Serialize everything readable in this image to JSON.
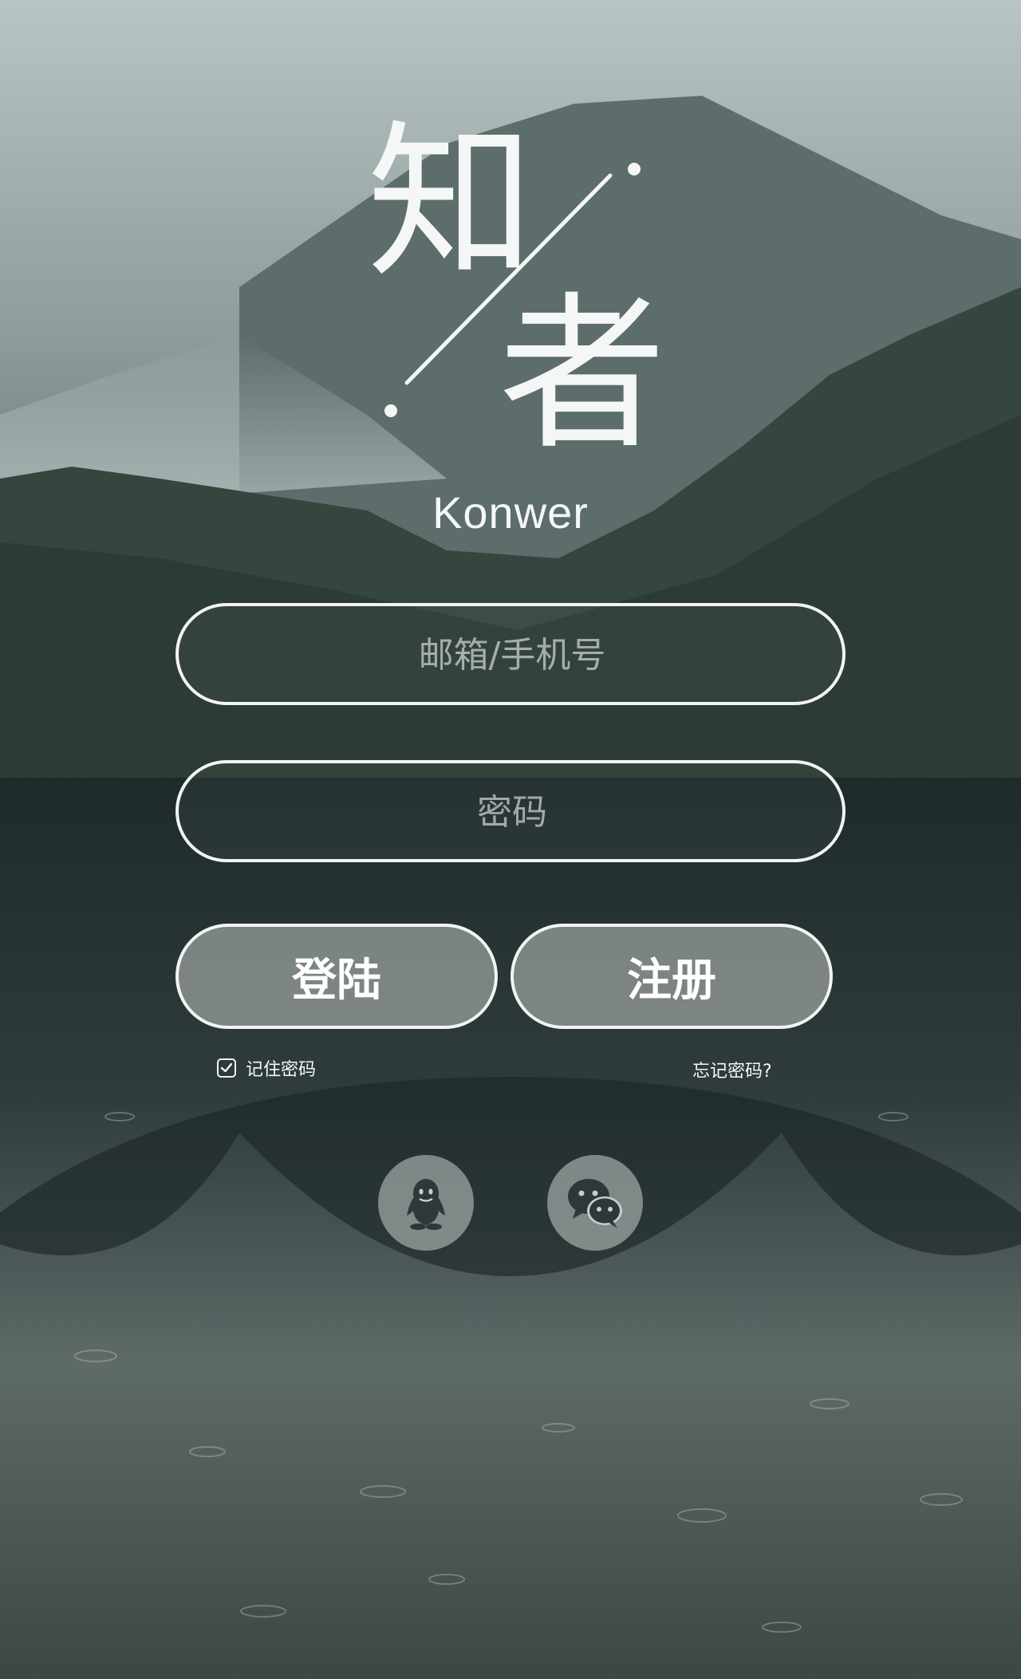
{
  "logo": {
    "char_first": "知",
    "char_second": "者",
    "brand": "Konwer"
  },
  "form": {
    "account_placeholder": "邮箱/手机号",
    "password_placeholder": "密码",
    "login_label": "登陆",
    "register_label": "注册",
    "remember_label": "记住密码",
    "remember_checked": true,
    "forgot_label": "忘记密码?"
  },
  "social": {
    "items": [
      {
        "icon": "qq-penguin-icon"
      },
      {
        "icon": "wechat-icon"
      }
    ]
  },
  "colors": {
    "text": "#ffffff",
    "button_fill": "#b9bebe",
    "border": "#f2f4f4"
  }
}
